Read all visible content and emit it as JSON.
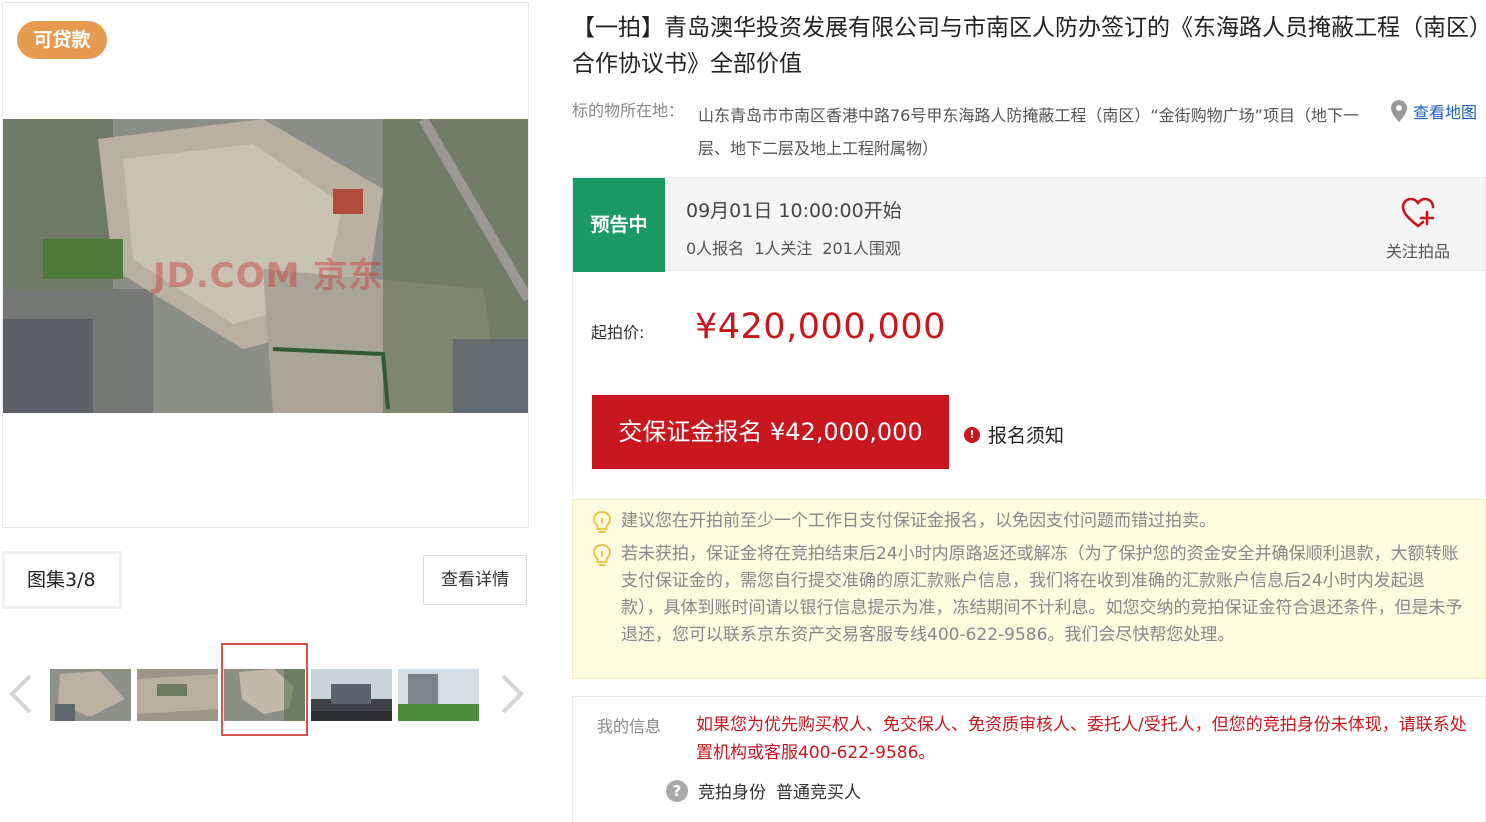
{
  "gallery": {
    "loan_badge": "可贷款",
    "watermark": "JD.COM 京东",
    "count_label": "图集3/8",
    "detail_button": "查看详情",
    "thumbnails": [
      "thumb-1",
      "thumb-2",
      "thumb-3",
      "thumb-4",
      "thumb-5"
    ],
    "active_thumb": 3
  },
  "lot": {
    "title": "【一拍】青岛澳华投资发展有限公司与市南区人防办签订的《东海路人员掩蔽工程（南区）合作协议书》全部价值",
    "location_label": "标的物所在地：",
    "location": "山东青岛市市南区香港中路76号甲东海路人防掩蔽工程（南区）“金街购物广场”项目（地下一层、地下二层及地上工程附属物）",
    "map_link": "查看地图"
  },
  "status": {
    "badge": "预告中",
    "start_time": "09月01日 10:00:00开始",
    "signups": "0人报名",
    "followers": "1人关注",
    "viewers": "201人围观",
    "follow_label": "关注拍品"
  },
  "price": {
    "label": "起拍价:",
    "value": "¥420,000,000",
    "deposit_button": "交保证金报名 ¥42,000,000",
    "notice_link": "报名须知"
  },
  "tips": [
    "建议您在开拍前至少一个工作日支付保证金报名，以免因支付问题而错过拍卖。",
    "若未获拍，保证金将在竞拍结束后24小时内原路返还或解冻（为了保护您的资金安全并确保顺利退款，大额转账支付保证金的，需您自行提交准确的原汇款账户信息，我们将在收到准确的汇款账户信息后24小时内发起退款），具体到账时间请以银行信息提示为准，冻结期间不计利息。如您交纳的竞拍保证金符合退还条件，但是未予退还，您可以联系京东资产交易客服专线400-622-9586。我们会尽快帮您处理。"
  ],
  "my_info": {
    "label": "我的信息",
    "notice": "如果您为优先购买权人、免交保人、免资质审核人、委托人/受托人，但您的竞拍身份未体现，请联系处置机构或客服400-622-9586。",
    "identity_label": "竞拍身份",
    "identity_value": "普通竞买人"
  },
  "colors": {
    "brand_red": "#c8171e",
    "status_green": "#1b9a64",
    "loan_orange": "#e89a4f",
    "link_blue": "#1e62c4"
  }
}
